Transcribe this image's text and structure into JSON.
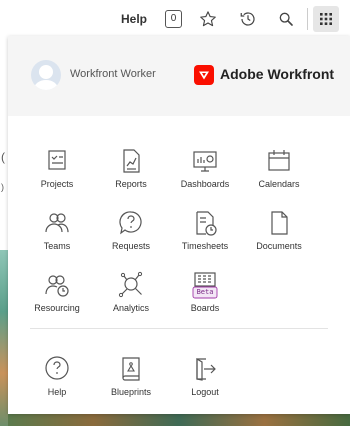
{
  "topbar": {
    "help_label": "Help",
    "notification_count": "0",
    "icons": [
      "star-icon",
      "history-icon",
      "search-icon",
      "app-launcher-icon"
    ]
  },
  "panel": {
    "user_name": "Workfront Worker",
    "brand": "Adobe Workfront",
    "brand_color": "#fa0f00"
  },
  "apps": [
    {
      "label": "Projects",
      "icon": "projects-icon"
    },
    {
      "label": "Reports",
      "icon": "reports-icon"
    },
    {
      "label": "Dashboards",
      "icon": "dashboards-icon"
    },
    {
      "label": "Calendars",
      "icon": "calendars-icon"
    },
    {
      "label": "Teams",
      "icon": "teams-icon"
    },
    {
      "label": "Requests",
      "icon": "requests-icon"
    },
    {
      "label": "Timesheets",
      "icon": "timesheets-icon"
    },
    {
      "label": "Documents",
      "icon": "documents-icon"
    },
    {
      "label": "Resourcing",
      "icon": "resourcing-icon"
    },
    {
      "label": "Analytics",
      "icon": "analytics-icon"
    },
    {
      "label": "Boards",
      "icon": "boards-icon",
      "badge": "Beta"
    }
  ],
  "footer_apps": [
    {
      "label": "Help",
      "icon": "help-icon"
    },
    {
      "label": "Blueprints",
      "icon": "blueprints-icon"
    },
    {
      "label": "Logout",
      "icon": "logout-icon"
    }
  ]
}
